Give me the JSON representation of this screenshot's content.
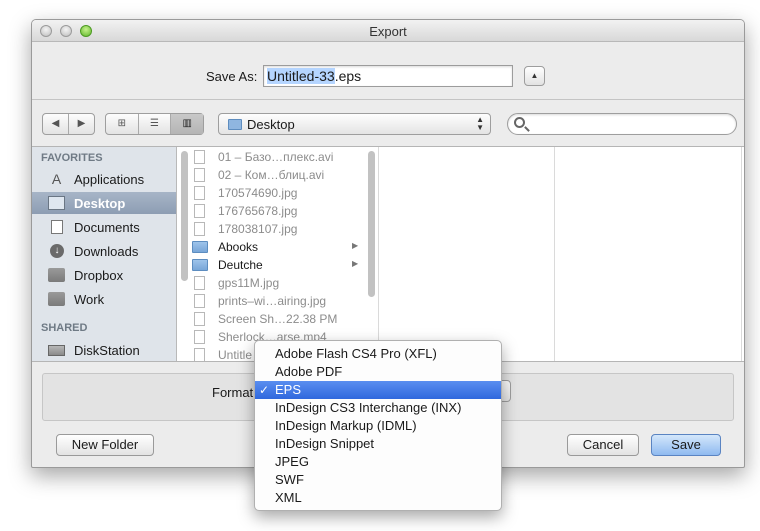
{
  "window": {
    "title": "Export"
  },
  "save_as": {
    "label": "Save As:",
    "selected_text": "Untitled-33",
    "extension_text": ".eps"
  },
  "toolbar": {
    "nav_back": "◀",
    "nav_forward": "▶",
    "view_icons": "⊞",
    "view_list": "☰",
    "view_columns": "▥",
    "location": "Desktop",
    "location_arrows": "▲▼",
    "search_placeholder": ""
  },
  "sidebar": {
    "favorites_header": "FAVORITES",
    "favorites": [
      {
        "label": "Applications",
        "icon": "applications-icon",
        "selected": false
      },
      {
        "label": "Desktop",
        "icon": "desktop-icon",
        "selected": true
      },
      {
        "label": "Documents",
        "icon": "documents-icon",
        "selected": false
      },
      {
        "label": "Downloads",
        "icon": "downloads-icon",
        "selected": false
      },
      {
        "label": "Dropbox",
        "icon": "folder-icon",
        "selected": false
      },
      {
        "label": "Work",
        "icon": "folder-icon",
        "selected": false
      }
    ],
    "shared_header": "SHARED",
    "shared": [
      {
        "label": "DiskStation",
        "icon": "nas-icon",
        "selected": false
      }
    ]
  },
  "files": [
    {
      "name": "01 – Базо…плекс.avi",
      "type": "file",
      "enabled": false
    },
    {
      "name": "02 – Ком…блиц.avi",
      "type": "file",
      "enabled": false
    },
    {
      "name": "170574690.jpg",
      "type": "file",
      "enabled": false
    },
    {
      "name": "176765678.jpg",
      "type": "file",
      "enabled": false
    },
    {
      "name": "178038107.jpg",
      "type": "file",
      "enabled": false
    },
    {
      "name": "Abooks",
      "type": "folder",
      "enabled": true
    },
    {
      "name": "Deutche",
      "type": "folder",
      "enabled": true
    },
    {
      "name": "gps11M.jpg",
      "type": "file",
      "enabled": false
    },
    {
      "name": "prints–wi…airing.jpg",
      "type": "file",
      "enabled": false
    },
    {
      "name": "Screen Sh…22.38 PM",
      "type": "file",
      "enabled": false
    },
    {
      "name": "Sherlock…arse.mp4",
      "type": "file",
      "enabled": false
    },
    {
      "name": "Untitle",
      "type": "file",
      "enabled": false
    }
  ],
  "format": {
    "label": "Format",
    "options": [
      {
        "label": "Adobe Flash CS4 Pro (XFL)",
        "selected": false
      },
      {
        "label": "Adobe PDF",
        "selected": false
      },
      {
        "label": "EPS",
        "selected": true
      },
      {
        "label": "InDesign CS3 Interchange (INX)",
        "selected": false
      },
      {
        "label": "InDesign Markup (IDML)",
        "selected": false
      },
      {
        "label": "InDesign Snippet",
        "selected": false
      },
      {
        "label": "JPEG",
        "selected": false
      },
      {
        "label": "SWF",
        "selected": false
      },
      {
        "label": "XML",
        "selected": false
      }
    ],
    "check_mark": "✓"
  },
  "buttons": {
    "new_folder": "New Folder",
    "cancel": "Cancel",
    "save": "Save"
  }
}
